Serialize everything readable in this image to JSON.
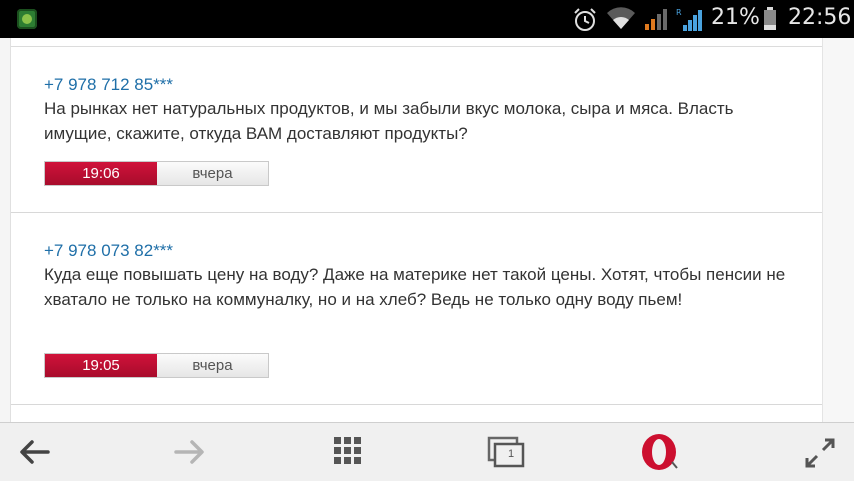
{
  "status_bar": {
    "battery_percent": "21%",
    "time": "22:56",
    "icons": [
      "app-icon",
      "alarm-icon",
      "wifi-icon",
      "signal-icon",
      "signal-roaming-icon",
      "battery-icon"
    ]
  },
  "messages": [
    {
      "phone": "+7 978 712 85***",
      "text": "На рынках нет натуральных продуктов, и мы забыли вкус молока, сыра и мяса. Власть имущие, скажите, откуда ВАМ доставляют продукты?",
      "time": "19:06",
      "day": "вчера"
    },
    {
      "phone": "+7 978 073 82***",
      "text": "Куда еще повышать цену на воду? Даже на материке нет такой цены. Хотят, чтобы пенсии не хватало не только на коммуналку, но и на хлеб? Ведь не только одну воду пьем!",
      "time": "19:05",
      "day": "вчера"
    }
  ],
  "toolbar": {
    "tab_count": "1",
    "icons": [
      "back-arrow-icon",
      "forward-arrow-icon",
      "speed-dial-grid-icon",
      "tabs-icon",
      "opera-logo-icon",
      "fullscreen-arrows-icon"
    ],
    "accent_color": "#d0123a"
  }
}
